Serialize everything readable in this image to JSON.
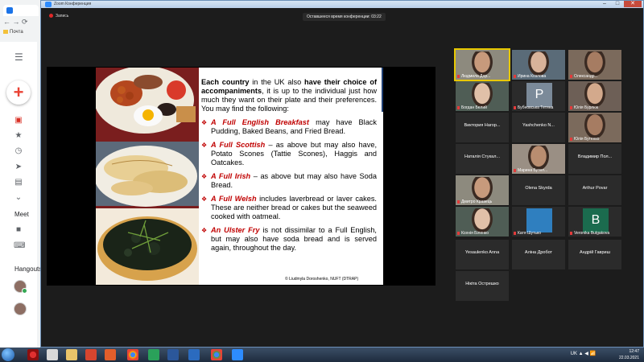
{
  "browser": {
    "tab_title": "Почта",
    "bookmark": "Почта"
  },
  "sidebar": {
    "meet_label": "Meet",
    "hangouts_label": "Hangouts"
  },
  "zoom": {
    "window_title": "Zoom Конференция",
    "recording_label": "Запись",
    "timer_text": "Оставшееся время конференции: 03:22"
  },
  "slide": {
    "intro_lead": "Each country",
    "intro_mid1": " in the UK also ",
    "intro_bold2": "have their choice of accompaniments",
    "intro_rest": ", it is up to the individual just how much they want on their plate and their preferences. You may find the following:",
    "items": [
      {
        "keyword": "A Full English Breakfast",
        "text": " may have Black Pudding, Baked Beans, and Fried Bread."
      },
      {
        "keyword": "A Full Scottish",
        "text": " – as above but may also have, Potato Scones (Tattie Scones), Haggis and Oatcakes."
      },
      {
        "keyword": "A Full Irish",
        "text": " – as above but may also have Soda Bread."
      },
      {
        "keyword": "A Full Welsh",
        "text": " includes laverbread or laver cakes. These are neither bread or cakes but the seaweed cooked with oatmeal."
      },
      {
        "keyword": "An Ulster Fry",
        "text": " is not dissimilar to a Full English, but may also have soda bread and is served again, throughout the day."
      }
    ],
    "copyright": "© Liudmyla Doroshenko, NUFT (DTRAP)"
  },
  "participants": [
    {
      "name": "Людмила Дор...",
      "kind": "video",
      "active": true
    },
    {
      "name": "Ирина Козлова",
      "kind": "video"
    },
    {
      "name": "Олександр...",
      "kind": "video"
    },
    {
      "name": "Богдан Белий",
      "kind": "video"
    },
    {
      "name": "Бубновська Тетяна",
      "kind": "letter",
      "letter": "P",
      "color": "#7b8a99"
    },
    {
      "name": "Юлія Бурлюк",
      "kind": "video"
    },
    {
      "name": "Виктория Нагор...",
      "kind": "name"
    },
    {
      "name": "Yashchenko N...",
      "kind": "name"
    },
    {
      "name": "Юлія Бутенко",
      "kind": "video"
    },
    {
      "name": "Наталія Стукал...",
      "kind": "name"
    },
    {
      "name": "Марина Бутел...",
      "kind": "video"
    },
    {
      "name": "Владимир Пол...",
      "kind": "name"
    },
    {
      "name": "Дмитро Кравець",
      "kind": "video"
    },
    {
      "name": "Olena Skyrda",
      "kind": "name"
    },
    {
      "name": "Arthur Povar",
      "kind": "name"
    },
    {
      "name": "Ксенія Біленко",
      "kind": "video"
    },
    {
      "name": "Катя Шутько",
      "kind": "solid",
      "color": "#2f7fbf"
    },
    {
      "name": "Veronika Bulgakova",
      "kind": "letter",
      "letter": "B",
      "color": "#1b6b4e"
    },
    {
      "name": "Yesaulenko Anna",
      "kind": "name"
    },
    {
      "name": "Аліна Дробот",
      "kind": "name"
    },
    {
      "name": "Андрій Гавриш",
      "kind": "name"
    },
    {
      "name": "Нікіта Острешко",
      "kind": "name"
    }
  ],
  "taskbar": {
    "tray_text": "UK ▲ ◀ 📶",
    "time": "12:47",
    "date": "22.03.2021"
  }
}
